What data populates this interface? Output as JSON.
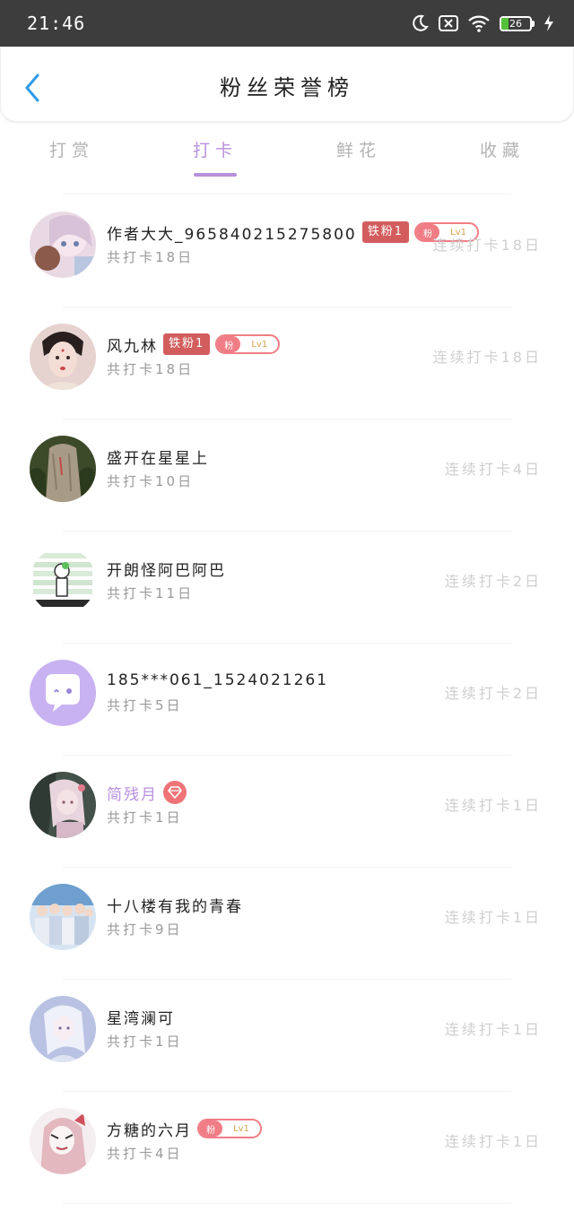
{
  "status_bar": {
    "time": "21:46",
    "battery_level": "26",
    "icons": [
      "moon-icon",
      "sim-off-icon",
      "wifi-icon",
      "battery-icon",
      "charging-icon"
    ]
  },
  "header": {
    "title": "粉丝荣誉榜",
    "back_icon": "chevron-left-icon"
  },
  "tabs": [
    {
      "label": "打赏",
      "active": false
    },
    {
      "label": "打卡",
      "active": true
    },
    {
      "label": "鲜花",
      "active": false
    },
    {
      "label": "收藏",
      "active": false
    }
  ],
  "colors": {
    "accent": "#b890dd",
    "badge_red": "#d35d5d",
    "fan_pink": "#f07d85",
    "status_bar": "#3d3d3d",
    "back_blue": "#2f9be8"
  },
  "rows": [
    {
      "name": "作者大大_965840215275800",
      "total": "共打卡18日",
      "streak": "连续打卡18日",
      "badge": "铁粉1",
      "fan_pill": {
        "left": "粉",
        "right": "Lv1"
      },
      "diamond": false,
      "name_color": "default"
    },
    {
      "name": "风九林",
      "total": "共打卡18日",
      "streak": "连续打卡18日",
      "badge": "铁粉1",
      "fan_pill": {
        "left": "粉",
        "right": "Lv1"
      },
      "diamond": false,
      "name_color": "default"
    },
    {
      "name": "盛开在星星上",
      "total": "共打卡10日",
      "streak": "连续打卡4日",
      "badge": null,
      "fan_pill": null,
      "diamond": false,
      "name_color": "default"
    },
    {
      "name": "开朗怪阿巴阿巴",
      "total": "共打卡11日",
      "streak": "连续打卡2日",
      "badge": null,
      "fan_pill": null,
      "diamond": false,
      "name_color": "default"
    },
    {
      "name": "185***061_1524021261",
      "total": "共打卡5日",
      "streak": "连续打卡2日",
      "badge": null,
      "fan_pill": null,
      "diamond": false,
      "name_color": "default"
    },
    {
      "name": "简残月",
      "total": "共打卡1日",
      "streak": "连续打卡1日",
      "badge": null,
      "fan_pill": null,
      "diamond": true,
      "name_color": "purple"
    },
    {
      "name": "十八楼有我的青春",
      "total": "共打卡9日",
      "streak": "连续打卡1日",
      "badge": null,
      "fan_pill": null,
      "diamond": false,
      "name_color": "default"
    },
    {
      "name": "星湾澜可",
      "total": "共打卡1日",
      "streak": "连续打卡1日",
      "badge": null,
      "fan_pill": null,
      "diamond": false,
      "name_color": "default"
    },
    {
      "name": "方糖的六月",
      "total": "共打卡4日",
      "streak": "连续打卡1日",
      "badge": null,
      "fan_pill": {
        "left": "粉",
        "right": "Lv1"
      },
      "diamond": false,
      "name_color": "default"
    }
  ]
}
